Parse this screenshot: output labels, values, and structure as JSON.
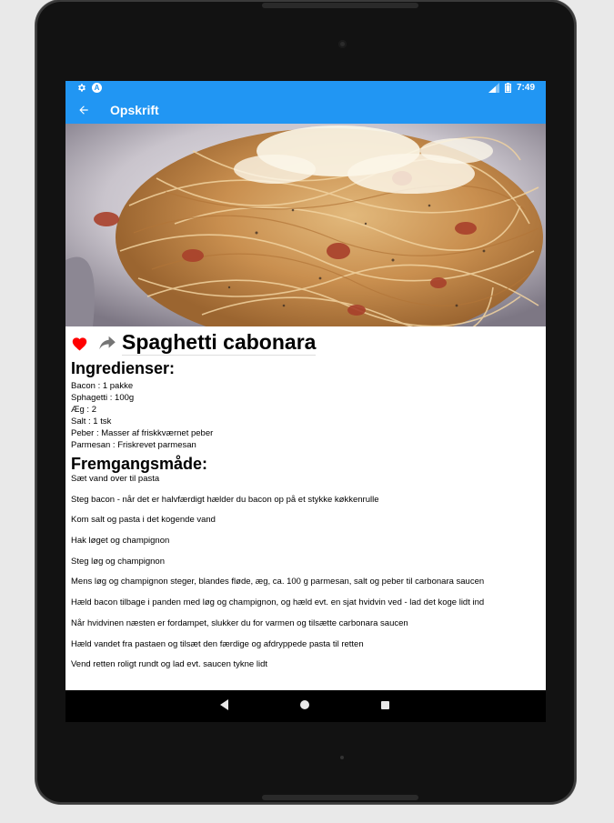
{
  "status_bar": {
    "time": "7:49",
    "left_icons": [
      "gear-icon",
      "a-icon"
    ],
    "a_glyph": "A",
    "right_icons": [
      "signal-icon",
      "battery-icon"
    ]
  },
  "toolbar": {
    "title": "Opskrift",
    "back_icon": "arrow-left-icon"
  },
  "colors": {
    "accent": "#2196f3",
    "favorite": "#ff0000",
    "share": "#757575"
  },
  "recipe": {
    "title": "Spaghetti cabonara",
    "image_icon": "photo-spaghetti-carbonara",
    "ingredients_heading": "Ingredienser:",
    "ingredients": [
      "Bacon : 1 pakke",
      "Sphagetti : 100g",
      "Æg : 2",
      "Salt : 1 tsk",
      "Peber : Masser af friskkværnet peber",
      "Parmesan : Friskrevet parmesan"
    ],
    "method_heading": "Fremgangsmåde:",
    "steps": [
      "Sæt vand over til pasta",
      "Steg bacon - når det er halvfærdigt hælder du bacon op på et stykke køkkenrulle",
      "Kom salt og pasta i det kogende vand",
      "Hak løget og champignon",
      "Steg løg og champignon",
      "Mens løg og champignon steger, blandes fløde, æg, ca. 100 g parmesan, salt og peber til carbonara saucen",
      "Hæld bacon tilbage i panden med løg og champignon, og hæld evt. en sjat hvidvin ved - lad det koge lidt ind",
      "Når hvidvinen næsten er fordampet, slukker du for varmen og tilsætte carbonara saucen",
      "Hæld vandet fra pastaen og tilsæt den færdige og afdryppede pasta til retten",
      "Vend retten roligt rundt og lad evt. saucen tykne lidt"
    ]
  },
  "nav_bar": {
    "icons": [
      "nav-back-icon",
      "nav-home-icon",
      "nav-recents-icon"
    ]
  }
}
